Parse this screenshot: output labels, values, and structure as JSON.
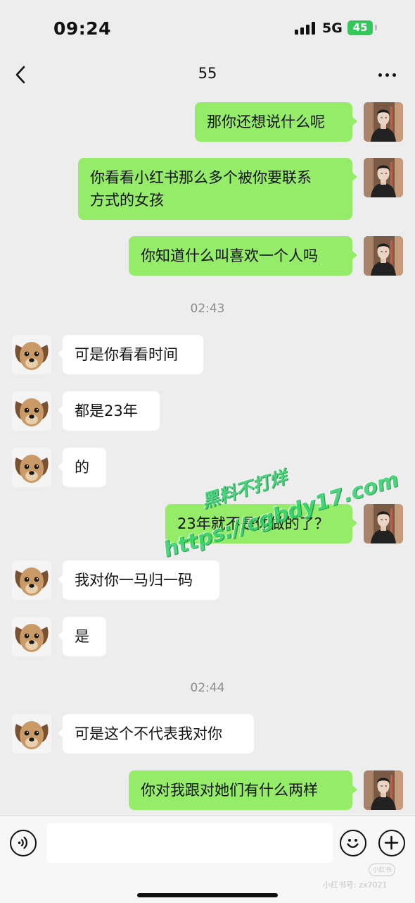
{
  "status_bar": {
    "time": "09:24",
    "network": "5G",
    "battery": "45"
  },
  "nav": {
    "title": "55",
    "back_icon": "chevron-left-icon",
    "more_icon": "more-horizontal-icon"
  },
  "messages": [
    {
      "side": "right",
      "text": "那你还想说什么呢"
    },
    {
      "side": "right",
      "text_lines": [
        "你看看小红书那么多个被你要联系",
        "方式的女孩"
      ]
    },
    {
      "side": "right",
      "text": "你知道什么叫喜欢一个人吗"
    },
    {
      "timestamp": "02:43"
    },
    {
      "side": "left",
      "text": "可是你看看时间"
    },
    {
      "side": "left",
      "text": "都是23年"
    },
    {
      "side": "left",
      "text": "的"
    },
    {
      "side": "right",
      "text": "23年就不是你做的了？"
    },
    {
      "side": "left",
      "text": "我对你一马归一码"
    },
    {
      "side": "left",
      "text": "是"
    },
    {
      "timestamp": "02:44"
    },
    {
      "side": "left",
      "text": "可是这个不代表我对你"
    },
    {
      "side": "right",
      "text": "你对我跟对她们有什么两样"
    }
  ],
  "watermark": {
    "line1": "黑料不打烊",
    "line2": "https://cgbdy17.com"
  },
  "input_bar": {
    "placeholder": "",
    "voice_icon": "voice-icon",
    "emoji_icon": "emoji-icon",
    "plus_icon": "plus-icon"
  },
  "footer": {
    "logo_text": "小红书",
    "user_id": "小红书号: zx7021"
  },
  "colors": {
    "background": "#ededed",
    "bubble_right": "#95ec69",
    "bubble_left": "#ffffff",
    "battery": "#34c759",
    "watermark": "#2fd36b"
  }
}
